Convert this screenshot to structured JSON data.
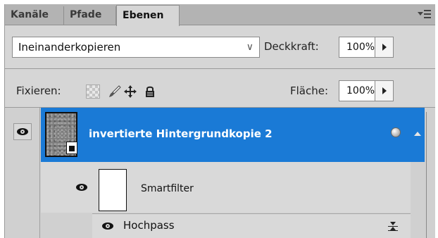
{
  "tabs": [
    {
      "label": "Kanäle",
      "active": false
    },
    {
      "label": "Pfade",
      "active": false
    },
    {
      "label": "Ebenen",
      "active": true
    }
  ],
  "blend": {
    "mode": "Ineinanderkopieren"
  },
  "opacity": {
    "label": "Deckkraft:",
    "value": "100%"
  },
  "lock": {
    "label": "Fixieren:",
    "icons": [
      "transparency-lock-icon",
      "brush-lock-icon",
      "move-lock-icon",
      "padlock-icon"
    ]
  },
  "fill": {
    "label": "Fläche:",
    "value": "100%"
  },
  "layers": {
    "main": {
      "name": "invertierte Hintergrundkopie 2",
      "selected": true,
      "visible": true
    },
    "smartfilter": {
      "name": "Smartfilter",
      "visible": true
    },
    "filter": {
      "name": "Hochpass",
      "visible": true
    }
  },
  "colors": {
    "selection": "#1a7ad6",
    "panel": "#d6d6d6",
    "tabbar": "#b3b3b3"
  }
}
